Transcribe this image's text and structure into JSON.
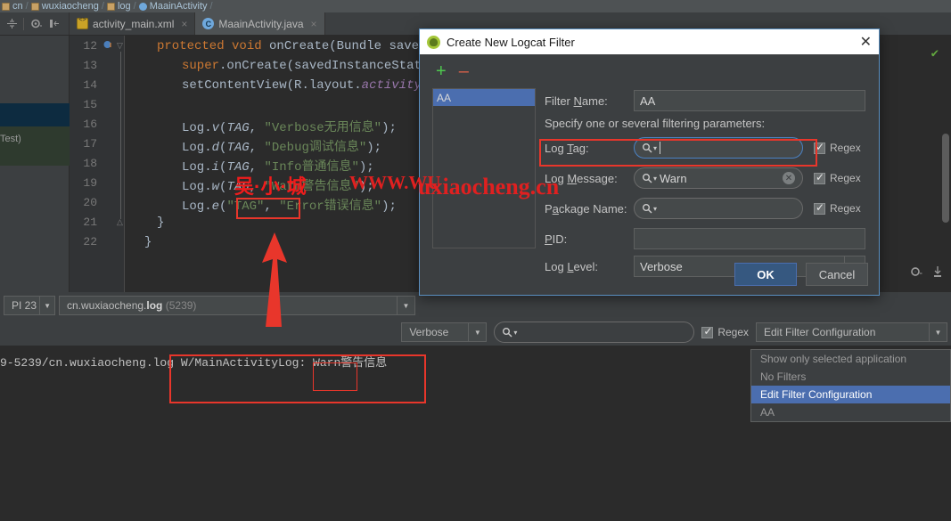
{
  "breadcrumb": {
    "items": [
      {
        "label": "cn",
        "icon": "package-icon"
      },
      {
        "label": "wuxiaocheng",
        "icon": "package-icon"
      },
      {
        "label": "log",
        "icon": "package-icon"
      },
      {
        "label": "MaainActivity",
        "icon": "class-icon"
      }
    ],
    "separator": "/"
  },
  "toolbar": {
    "icons": [
      "split-editor-icon",
      "settings-gear-icon",
      "collapse-pane-icon"
    ]
  },
  "tabs": [
    {
      "label": "activity_main.xml",
      "icon": "xml-file-icon",
      "close": "×",
      "active": false
    },
    {
      "label": "MaainActivity.java",
      "icon": "java-class-icon",
      "close": "×",
      "active": true
    }
  ],
  "editor": {
    "left_strip_label": "Test)",
    "status_check": "✔",
    "lines": [
      {
        "num": "12",
        "text": "protected void onCreate(Bundle savedI"
      },
      {
        "num": "13",
        "text": "super.onCreate(savedInstanceState"
      },
      {
        "num": "14",
        "text": "setContentView(R.layout.activity_"
      },
      {
        "num": "15",
        "text": ""
      },
      {
        "num": "16",
        "text": "Log.v(TAG, \"Verbose无用信息\");"
      },
      {
        "num": "17",
        "text": "Log.d(TAG, \"Debug调试信息\");"
      },
      {
        "num": "18",
        "text": "Log.i(TAG, \"Info普通信息\");"
      },
      {
        "num": "19",
        "text": "Log.w(TAG, \"Warn警告信息\");"
      },
      {
        "num": "20",
        "text": "Log.e(\"TAG\", \"Error错误信息\");"
      },
      {
        "num": "21",
        "text": "}"
      },
      {
        "num": "22",
        "text": "}"
      }
    ],
    "bottom_icons": [
      "gear-icon",
      "scroll-to-end-icon"
    ]
  },
  "logcat": {
    "device": {
      "value": "PI 23",
      "arrow": "▼"
    },
    "process": {
      "prefix": "cn.wuxiaocheng.",
      "bold": "log",
      "pid": "(5239)",
      "arrow": "▼"
    },
    "level": {
      "value": "Verbose",
      "arrow": "▼"
    },
    "search": {
      "value": "",
      "placeholder": "",
      "icon": "search-icon",
      "dropdown_arrow": "▾"
    },
    "regex": {
      "label": "Regex",
      "checked": true
    },
    "filter": {
      "value": "Edit Filter Configuration",
      "arrow": "▼"
    },
    "output_line": "9-5239/cn.wuxiaocheng.log W/MainActivityLog: Warn警告信息",
    "filter_dropdown": {
      "items": [
        {
          "label": "Show only selected application",
          "selected": false
        },
        {
          "label": "No Filters",
          "selected": false
        },
        {
          "label": "Edit Filter Configuration",
          "selected": true
        },
        {
          "label": "AA",
          "selected": false
        }
      ]
    }
  },
  "dialog": {
    "title": "Create New Logcat Filter",
    "icon": "android-studio-icon",
    "close": "✕",
    "add_button": "+",
    "remove_button": "–",
    "filter_list": [
      {
        "label": "AA",
        "selected": true
      }
    ],
    "fields": {
      "filter_name": {
        "label": "Filter Name:",
        "mnemonic": "N",
        "value": "AA"
      },
      "instruction": "Specify one or several filtering parameters:",
      "log_tag": {
        "label": "Log Tag:",
        "mnemonic": "T",
        "value": "",
        "regex_label": "Regex",
        "regex_checked": true,
        "focused": true
      },
      "log_message": {
        "label": "Log Message:",
        "mnemonic": "M",
        "value": "Warn",
        "regex_label": "Regex",
        "regex_checked": true,
        "clear": "✕"
      },
      "package_name": {
        "label": "Package Name:",
        "mnemonic": "a",
        "value": "",
        "regex_label": "Regex",
        "regex_checked": true
      },
      "pid": {
        "label": "PID:",
        "mnemonic": "P",
        "value": ""
      },
      "log_level": {
        "label": "Log Level:",
        "mnemonic": "L",
        "value": "Verbose",
        "arrow": "▼"
      }
    },
    "buttons": {
      "ok": "OK",
      "cancel": "Cancel"
    }
  },
  "watermarks": {
    "name": "吴·小·城",
    "url_upper": "WWW.WU",
    "url_lower": "uxiaocheng.cn",
    "url_full": "www.wuxiaocheng.cn"
  },
  "colors": {
    "accent_blue": "#4b6eaf",
    "annotation_red": "#e8362b",
    "editor_bg": "#2b2b2b",
    "panel_bg": "#3c3f41",
    "keyword_orange": "#cc7832",
    "string_green": "#6a8759",
    "field_purple": "#9876aa",
    "ok_button": "#365880",
    "green_check": "#62a83f"
  }
}
